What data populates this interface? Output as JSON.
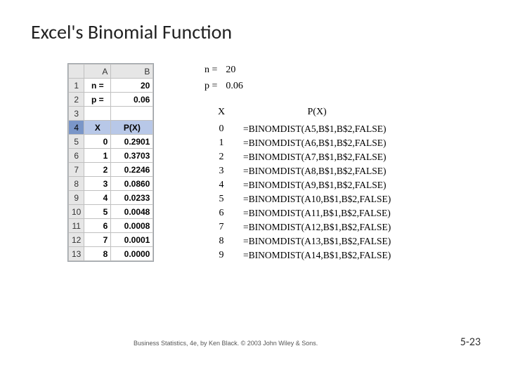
{
  "title": "Excel's Binomial Function",
  "params": {
    "n_label": "n =",
    "n_value": "20",
    "p_label": "p =",
    "p_value": "0.06"
  },
  "excel": {
    "colA": "A",
    "colB": "B",
    "r1": "1",
    "r2": "2",
    "r3": "3",
    "r4": "4",
    "r5": "5",
    "r6": "6",
    "r7": "7",
    "r8": "8",
    "r9": "9",
    "r10": "10",
    "r11": "11",
    "r12": "12",
    "r13": "13",
    "a1": "n =",
    "b1": "20",
    "a2": "p =",
    "b2": "0.06",
    "a4": "X",
    "b4": "P(X)",
    "a5": "0",
    "b5": "0.2901",
    "a6": "1",
    "b6": "0.3703",
    "a7": "2",
    "b7": "0.2246",
    "a8": "3",
    "b8": "0.0860",
    "a9": "4",
    "b9": "0.0233",
    "a10": "5",
    "b10": "0.0048",
    "a11": "6",
    "b11": "0.0008",
    "a12": "7",
    "b12": "0.0001",
    "a13": "8",
    "b13": "0.0000"
  },
  "formula": {
    "xh": "X",
    "ph": "P(X)",
    "rows": [
      {
        "x": "0",
        "p": "=BINOMDIST(A5,B$1,B$2,FALSE)"
      },
      {
        "x": "1",
        "p": "=BINOMDIST(A6,B$1,B$2,FALSE)"
      },
      {
        "x": "2",
        "p": "=BINOMDIST(A7,B$1,B$2,FALSE)"
      },
      {
        "x": "3",
        "p": "=BINOMDIST(A8,B$1,B$2,FALSE)"
      },
      {
        "x": "4",
        "p": "=BINOMDIST(A9,B$1,B$2,FALSE)"
      },
      {
        "x": "5",
        "p": "=BINOMDIST(A10,B$1,B$2,FALSE)"
      },
      {
        "x": "6",
        "p": "=BINOMDIST(A11,B$1,B$2,FALSE)"
      },
      {
        "x": "7",
        "p": "=BINOMDIST(A12,B$1,B$2,FALSE)"
      },
      {
        "x": "8",
        "p": "=BINOMDIST(A13,B$1,B$2,FALSE)"
      },
      {
        "x": "9",
        "p": "=BINOMDIST(A14,B$1,B$2,FALSE)"
      }
    ]
  },
  "footer": {
    "credit": "Business Statistics, 4e, by Ken Black. © 2003 John Wiley & Sons.",
    "page": "5-23"
  }
}
